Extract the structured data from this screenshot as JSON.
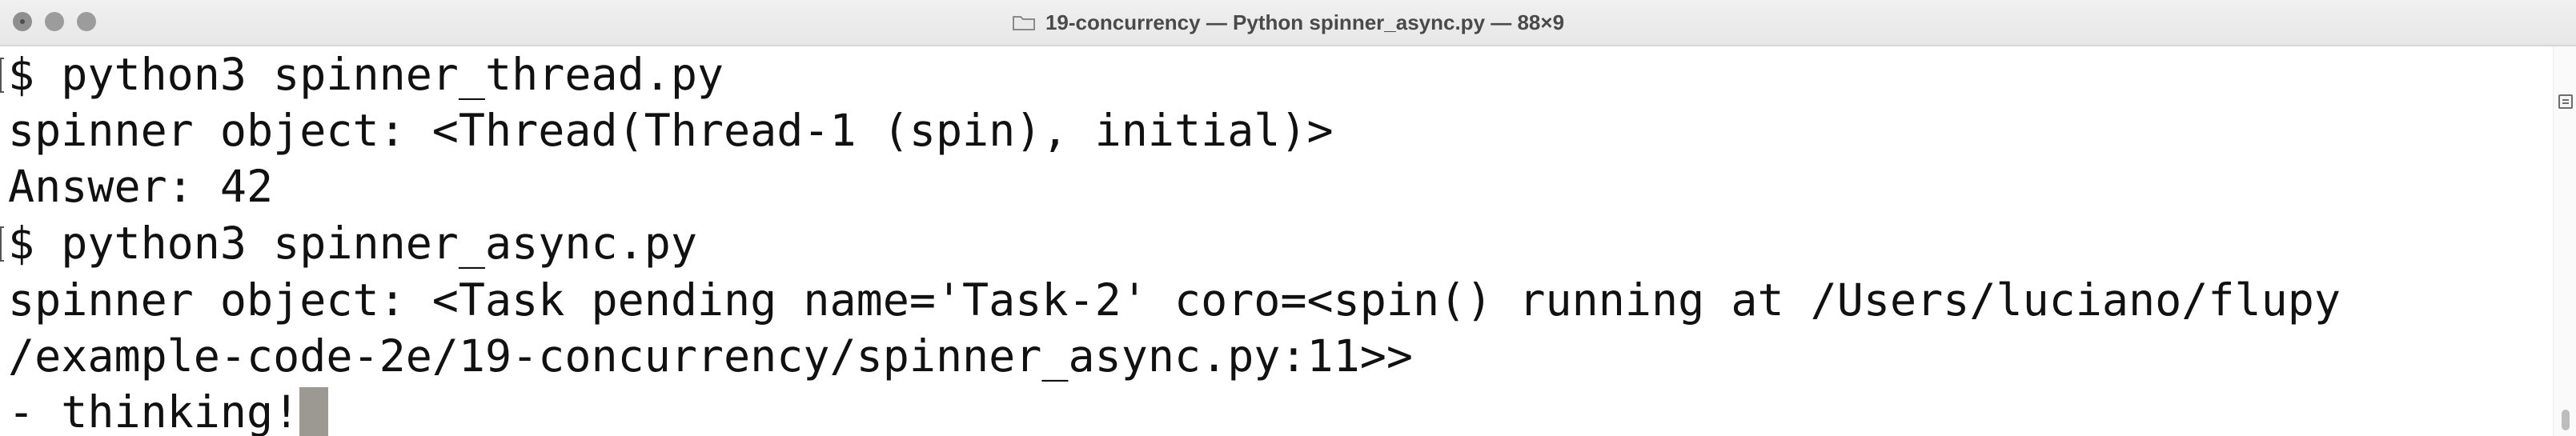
{
  "window": {
    "title": "19-concurrency — Python spinner_async.py — 88×9",
    "folder_icon": "folder-icon"
  },
  "terminal": {
    "lines": [
      "$ python3 spinner_thread.py",
      "spinner object: <Thread(Thread-1 (spin), initial)>",
      "Answer: 42",
      "$ python3 spinner_async.py",
      "spinner object: <Task pending name='Task-2' coro=<spin() running at /Users/luciano/flupy",
      "/example-code-2e/19-concurrency/spinner_async.py:11>>",
      "- thinking!"
    ],
    "cursor_color": "#9c9892"
  }
}
